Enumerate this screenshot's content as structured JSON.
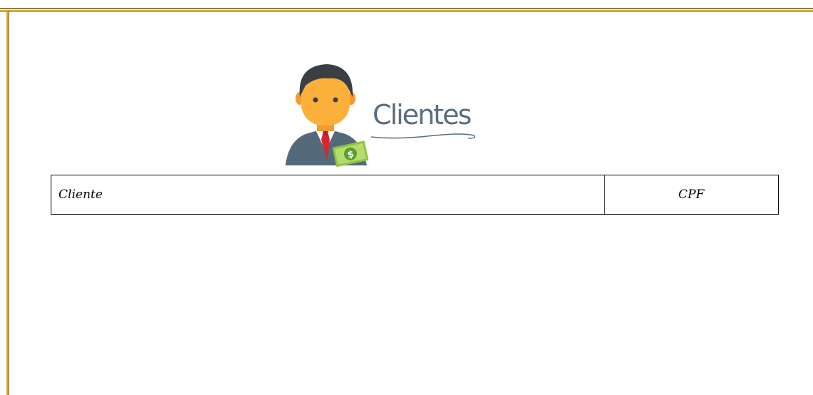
{
  "header": {
    "title": "Clientes",
    "icon": "businessman-with-money-icon"
  },
  "table": {
    "columns": [
      "Cliente",
      "CPF"
    ],
    "rows": []
  },
  "colors": {
    "frame_accent": "#d4a93a",
    "title_text": "#5a6d80"
  }
}
